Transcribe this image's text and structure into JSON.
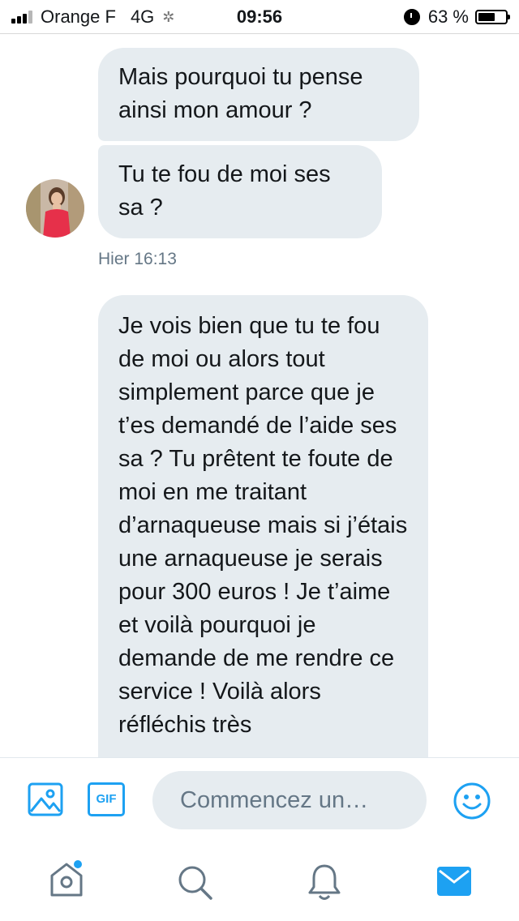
{
  "status_bar": {
    "carrier": "Orange F",
    "network": "4G",
    "time": "09:56",
    "battery": "63 %",
    "battery_level": 0.63
  },
  "conversation": {
    "messages": [
      {
        "text": "Mais pourquoi tu pense ainsi mon amour ?"
      },
      {
        "text": "Tu te fou de moi ses sa ?"
      },
      {
        "text": "Je vois bien que tu te fou de moi ou alors tout simplement parce que je t’es demandé de l’aide ses sa ? Tu prêtent te foute de moi en me traitant d’arnaqueuse mais si j’étais une arnaqueuse je serais pour 300 euros ! Je t’aime et voilà pourquoi je demande de me rendre ce service ! Voilà alors réfléchis très"
      }
    ],
    "timestamp": "Hier 16:13"
  },
  "composer": {
    "placeholder": "Commencez un…",
    "image_icon": "image-icon",
    "gif_label": "GIF",
    "emoji_icon": "emoji-icon"
  },
  "tab_bar": {
    "items": [
      "home-icon",
      "search-icon",
      "notifications-icon",
      "messages-icon"
    ]
  },
  "colors": {
    "accent": "#1da1f2",
    "bubble": "#e6ecf0",
    "tab_inactive": "#657786",
    "secondary_text": "#657786"
  }
}
